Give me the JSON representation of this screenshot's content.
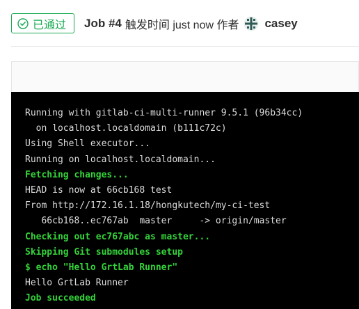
{
  "header": {
    "status_label": "已通过",
    "job_title": "Job #4",
    "triggered_text": "触发时间 just now 作者",
    "user_name": "casey"
  },
  "colors": {
    "success": "#1aaa55",
    "log_background": "#000000",
    "log_text": "#dddddd",
    "log_highlight": "#34d33a"
  },
  "log": {
    "lines": [
      {
        "text": "Running with gitlab-ci-multi-runner 9.5.1 (96b34cc)",
        "highlight": false
      },
      {
        "text": "  on localhost.localdomain (b111c72c)",
        "highlight": false
      },
      {
        "text": "Using Shell executor...",
        "highlight": false
      },
      {
        "text": "Running on localhost.localdomain...",
        "highlight": false
      },
      {
        "text": "Fetching changes...",
        "highlight": true
      },
      {
        "text": "HEAD is now at 66cb168 test",
        "highlight": false
      },
      {
        "text": "From http://172.16.1.18/hongkutech/my-ci-test",
        "highlight": false
      },
      {
        "text": "   66cb168..ec767ab  master     -> origin/master",
        "highlight": false
      },
      {
        "text": "Checking out ec767abc as master...",
        "highlight": true
      },
      {
        "text": "Skipping Git submodules setup",
        "highlight": true
      },
      {
        "text": "$ echo \"Hello GrtLab Runner\"",
        "highlight": true
      },
      {
        "text": "Hello GrtLab Runner",
        "highlight": false
      },
      {
        "text": "Job succeeded",
        "highlight": true
      }
    ]
  }
}
